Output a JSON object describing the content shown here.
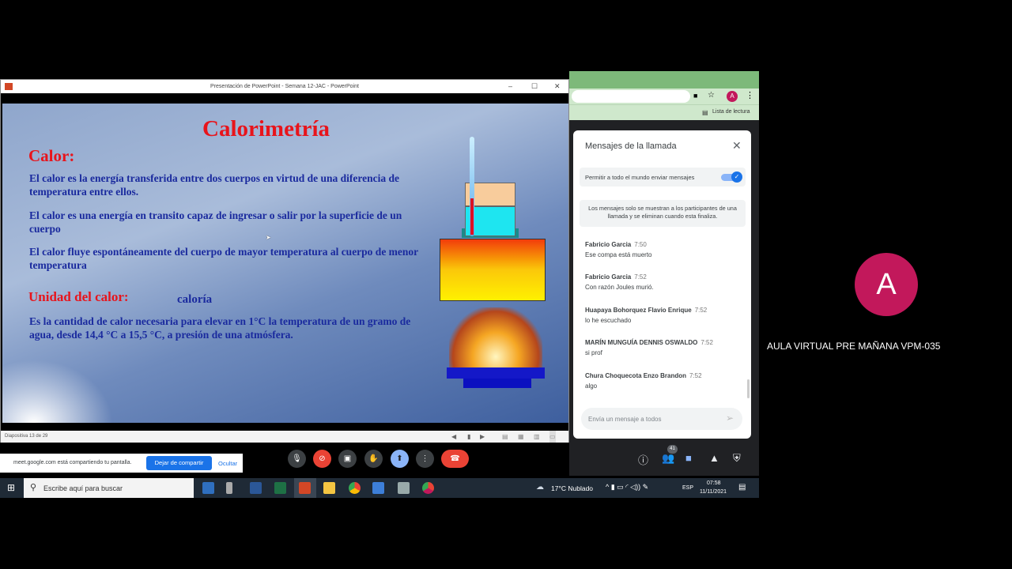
{
  "powerpoint": {
    "window_title": "Presentación de PowerPoint  -  Semana 12-JAC - PowerPoint",
    "status": "Diapositiva 13 de 29",
    "slide": {
      "title": "Calorimetría",
      "heading1": "Calor:",
      "paragraphs": [
        "El calor es la energía transferida entre dos cuerpos en virtud de una diferencia de temperatura entre ellos.",
        "El calor es una energía en transito capaz de ingresar o salir por la superficie de un cuerpo",
        "El calor fluye espontáneamente del cuerpo de mayor temperatura al cuerpo de menor temperatura"
      ],
      "heading2": "Unidad del calor:",
      "unit": "caloría",
      "definition": "Es la cantidad de calor necesaria para elevar en 1°C la temperatura de un gramo de agua, desde 14,4 °C a  15,5 °C, a presión de una atmósfera."
    }
  },
  "browser": {
    "profile_initial": "A",
    "reading_list": "Lista de lectura"
  },
  "chat": {
    "title": "Mensajes de la llamada",
    "allow_label": "Permitir a todo el mundo enviar mensajes",
    "allow_on": true,
    "notice": "Los mensajes solo se muestran a los participantes de una llamada y se eliminan cuando esta finaliza.",
    "messages": [
      {
        "name": "Fabricio Garcia",
        "time": "7:50",
        "text": "Ese compa está muerto"
      },
      {
        "name": "Fabricio Garcia",
        "time": "7:52",
        "text": "Con razón Joules murió."
      },
      {
        "name": "Huapaya Bohorquez Flavio Enrique",
        "time": "7:52",
        "text": "lo he escuchado"
      },
      {
        "name": "MARÍN MUNGUÍA DENNIS OSWALDO",
        "time": "7:52",
        "text": "si prof"
      },
      {
        "name": "Chura Choquecota Enzo Brandon",
        "time": "7:52",
        "text": "algo"
      }
    ],
    "input_placeholder": "Envía un mensaje a todos"
  },
  "participant": {
    "initial": "A",
    "name": "AULA VIRTUAL PRE MAÑANA VPM-035",
    "color": "#c2185b"
  },
  "share_bar": {
    "text": "meet.google.com está compartiendo tu pantalla.",
    "stop": "Dejar de compartir",
    "hide": "Ocultar"
  },
  "meet": {
    "participants_count": "41"
  },
  "taskbar": {
    "search_placeholder": "Escribe aquí para buscar",
    "weather": "17°C  Nublado",
    "lang": "ESP",
    "time": "07:58",
    "date": "11/11/2021"
  }
}
